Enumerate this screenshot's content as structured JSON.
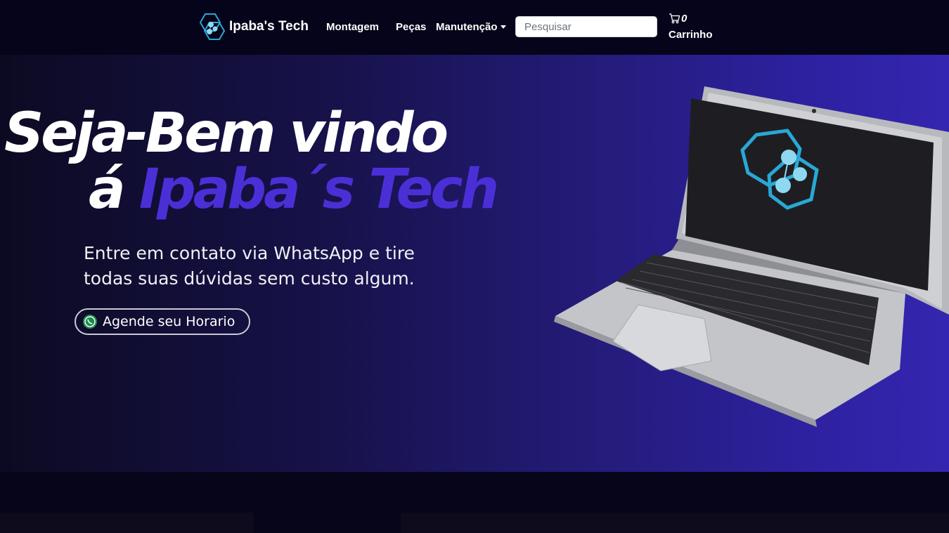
{
  "nav": {
    "brand": "Ipaba's Tech",
    "links": [
      "Montagem",
      "Peças",
      "Manutenção"
    ],
    "search_placeholder": "Pesquisar",
    "cart_count": "0",
    "cart_label": "Carrinho"
  },
  "hero": {
    "title_line1": "Seja-Bem vindo",
    "title_line2_prefix": "á",
    "title_line2_brand": "Ipaba´s Tech",
    "description": "Entre em contato via WhatsApp e tire todas suas dúvidas sem custo algum.",
    "cta_label": "Agende seu Horario"
  },
  "icons": {
    "brand": "hexagon-logo-icon",
    "cart": "shopping-cart-icon",
    "dropdown": "chevron-down-icon",
    "cta": "whatsapp-icon"
  },
  "colors": {
    "navbar_bg": "#06041a",
    "accent": "#4b2fd6",
    "logo_cyan": "#29a8d6"
  }
}
